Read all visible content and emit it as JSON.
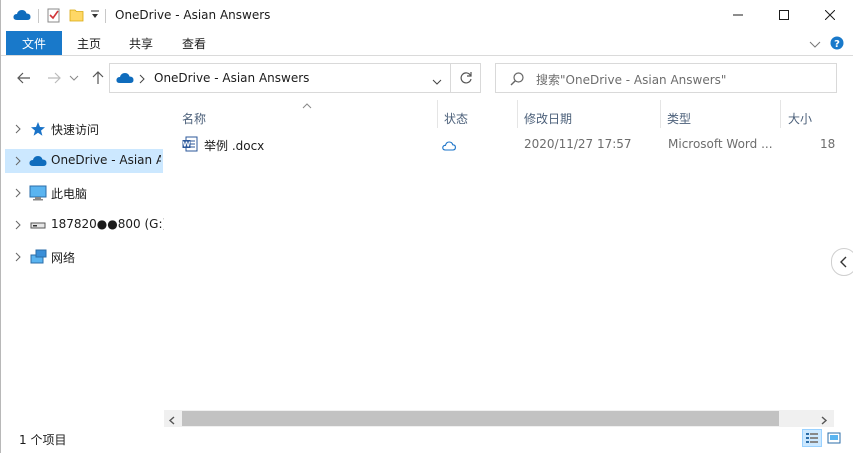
{
  "window": {
    "title": "OneDrive - Asian Answers"
  },
  "ribbon": {
    "file_tab": "文件",
    "tabs": [
      "主页",
      "共享",
      "查看"
    ]
  },
  "address": {
    "path": "OneDrive - Asian Answers",
    "search_placeholder": "搜索\"OneDrive - Asian Answers\""
  },
  "nav": {
    "items": [
      {
        "label": "快速访问",
        "icon": "quick-access-star-icon"
      },
      {
        "label": "OneDrive - Asian A",
        "icon": "onedrive-cloud-icon",
        "selected": true
      },
      {
        "label": "此电脑",
        "icon": "this-pc-icon"
      },
      {
        "label": "187820●●800 (G:)",
        "icon": "drive-icon"
      },
      {
        "label": "网络",
        "icon": "network-icon"
      }
    ]
  },
  "columns": [
    "名称",
    "状态",
    "修改日期",
    "类型",
    "大小"
  ],
  "files": [
    {
      "name": "举例 .docx",
      "status_icon": "cloud-status-icon",
      "modified": "2020/11/27 17:57",
      "type": "Microsoft Word ...",
      "size": "18"
    }
  ],
  "status": {
    "item_count": "1 个项目"
  },
  "colors": {
    "accent": "#1979ca",
    "selected": "#cce8ff",
    "header_text": "#4c607a"
  }
}
